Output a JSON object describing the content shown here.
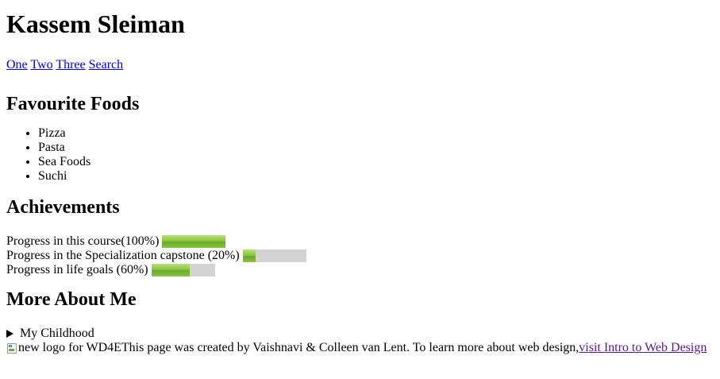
{
  "header": {
    "title": "Kassem Sleiman"
  },
  "nav": {
    "links": [
      "One",
      "Two",
      "Three",
      "Search"
    ]
  },
  "foods": {
    "heading": "Favourite Foods",
    "items": [
      "Pizza",
      "Pasta",
      "Sea Foods",
      "Suchi"
    ]
  },
  "achievements": {
    "heading": "Achievements",
    "items": [
      {
        "label": "Progress in this course(100%)",
        "value": 100
      },
      {
        "label": "Progress in the Specialization capstone (20%)",
        "value": 20
      },
      {
        "label": "Progress in life goals (60%)",
        "value": 60
      }
    ],
    "bar_fill_color": "#8cc63f",
    "bar_track_color": "#d3d3d3"
  },
  "more": {
    "heading": "More About Me",
    "details_summary": "My Childhood"
  },
  "footer": {
    "image_alt": "new logo for WD4E",
    "text": "This page was created by Vaishnavi & Colleen van Lent. To learn more about web design,",
    "link_text": "visit Intro to Web Design"
  },
  "colors": {
    "link": "#0000ee",
    "visited_link": "#551a8b"
  }
}
